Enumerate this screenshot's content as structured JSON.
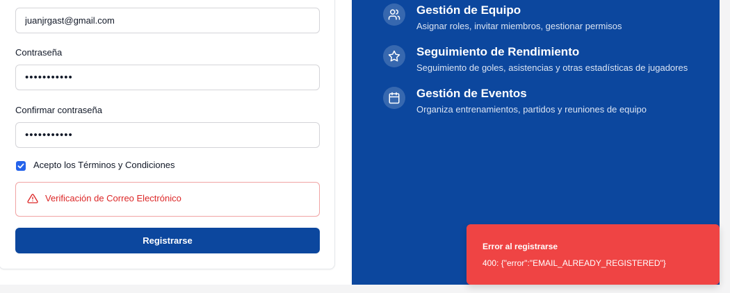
{
  "form": {
    "email_value": "juanjrgast@gmail.com",
    "password_label": "Contraseña",
    "password_value": "•••••••••••",
    "confirm_label": "Confirmar contraseña",
    "confirm_value": "•••••••••••",
    "terms_checked": true,
    "terms_label": "Acepto los Términos y Condiciones",
    "alert_text": "Verificación de Correo Electrónico",
    "submit_label": "Registrarse"
  },
  "features": [
    {
      "icon": "users-icon",
      "title": "Gestión de Equipo",
      "description": "Asignar roles, invitar miembros, gestionar permisos"
    },
    {
      "icon": "star-icon",
      "title": "Seguimiento de Rendimiento",
      "description": "Seguimiento de goles, asistencias y otras estadísticas de jugadores"
    },
    {
      "icon": "calendar-icon",
      "title": "Gestión de Eventos",
      "description": "Organiza entrenamientos, partidos y reuniones de equipo"
    }
  ],
  "toast": {
    "title": "Error al registrarse",
    "message": "400: {\"error\":\"EMAIL_ALREADY_REGISTERED\"}"
  },
  "colors": {
    "brand": "#0c479e",
    "error": "#ef4444",
    "checkbox": "#2563eb"
  }
}
